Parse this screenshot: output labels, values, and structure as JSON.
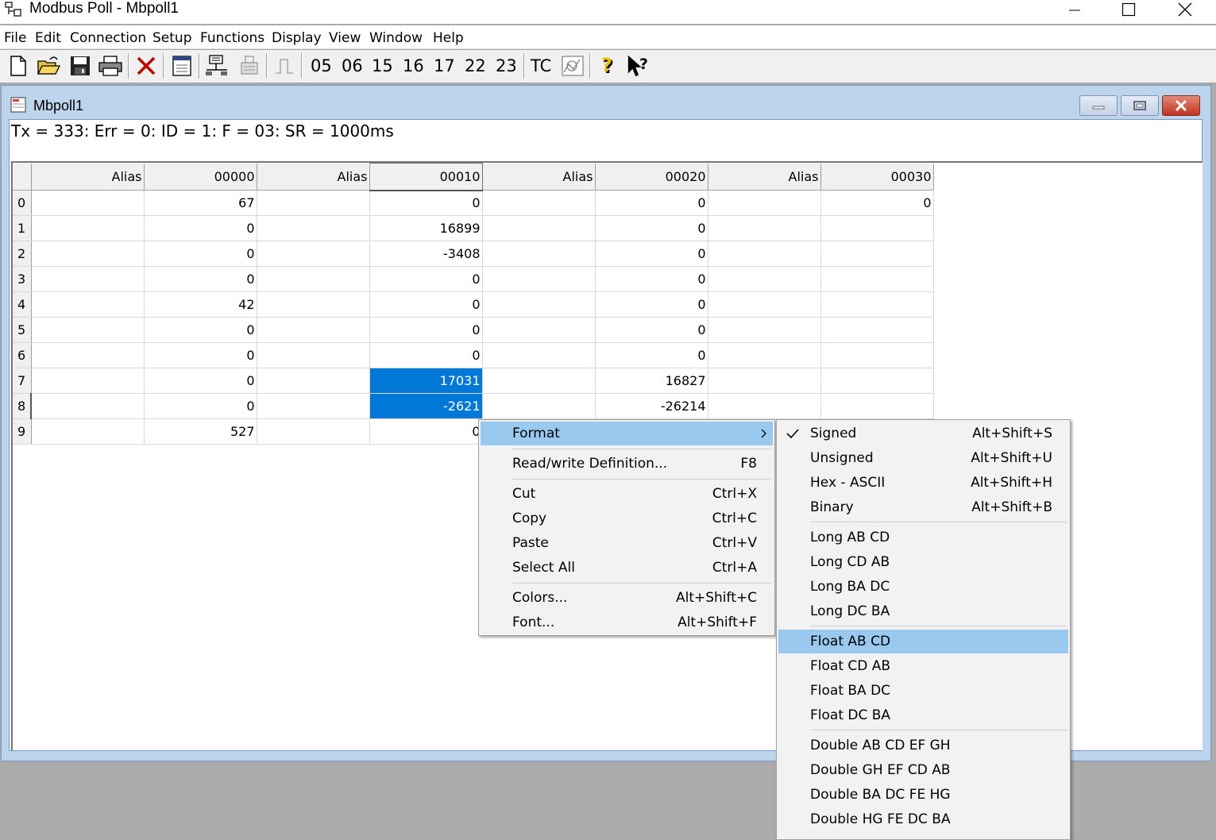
{
  "window": {
    "title": "Modbus Poll - Mbpoll1"
  },
  "menubar": [
    "File",
    "Edit",
    "Connection",
    "Setup",
    "Functions",
    "Display",
    "View",
    "Window",
    "Help"
  ],
  "toolbar": {
    "function_codes": [
      "05",
      "06",
      "15",
      "16",
      "17",
      "22",
      "23"
    ],
    "tc_label": "TC"
  },
  "child": {
    "title": "Mbpoll1",
    "status": "Tx = 333: Err = 0: ID = 1: F = 03: SR = 1000ms"
  },
  "grid": {
    "columns": [
      "Alias",
      "00000",
      "Alias",
      "00010",
      "Alias",
      "00020",
      "Alias",
      "00030"
    ],
    "rows": [
      {
        "index": "0",
        "v00000": "67",
        "v00010": "0",
        "v00020": "0",
        "v00030": "0"
      },
      {
        "index": "1",
        "v00000": "0",
        "v00010": "16899",
        "v00020": "0",
        "v00030": ""
      },
      {
        "index": "2",
        "v00000": "0",
        "v00010": "-3408",
        "v00020": "0",
        "v00030": ""
      },
      {
        "index": "3",
        "v00000": "0",
        "v00010": "0",
        "v00020": "0",
        "v00030": ""
      },
      {
        "index": "4",
        "v00000": "42",
        "v00010": "0",
        "v00020": "0",
        "v00030": ""
      },
      {
        "index": "5",
        "v00000": "0",
        "v00010": "0",
        "v00020": "0",
        "v00030": ""
      },
      {
        "index": "6",
        "v00000": "0",
        "v00010": "0",
        "v00020": "0",
        "v00030": ""
      },
      {
        "index": "7",
        "v00000": "0",
        "v00010": "17031",
        "v00020": "16827",
        "v00030": ""
      },
      {
        "index": "8",
        "v00000": "0",
        "v00010": "-2621",
        "v00020": "-26214",
        "v00030": ""
      },
      {
        "index": "9",
        "v00000": "527",
        "v00010": "0",
        "v00020": "",
        "v00030": ""
      }
    ]
  },
  "context_menu": {
    "format": "Format",
    "rw_definition": {
      "label": "Read/write Definition...",
      "shortcut": "F8"
    },
    "cut": {
      "label": "Cut",
      "shortcut": "Ctrl+X"
    },
    "copy": {
      "label": "Copy",
      "shortcut": "Ctrl+C"
    },
    "paste": {
      "label": "Paste",
      "shortcut": "Ctrl+V"
    },
    "select_all": {
      "label": "Select All",
      "shortcut": "Ctrl+A"
    },
    "colors": {
      "label": "Colors...",
      "shortcut": "Alt+Shift+C"
    },
    "font": {
      "label": "Font...",
      "shortcut": "Alt+Shift+F"
    }
  },
  "format_submenu": {
    "signed": {
      "label": "Signed",
      "shortcut": "Alt+Shift+S",
      "checked": true
    },
    "unsigned": {
      "label": "Unsigned",
      "shortcut": "Alt+Shift+U"
    },
    "hex_ascii": {
      "label": "Hex - ASCII",
      "shortcut": "Alt+Shift+H"
    },
    "binary": {
      "label": "Binary",
      "shortcut": "Alt+Shift+B"
    },
    "long_abcd": "Long AB CD",
    "long_cdab": "Long CD AB",
    "long_badc": "Long BA DC",
    "long_dcba": "Long DC BA",
    "float_abcd": "Float AB CD",
    "float_cdab": "Float CD AB",
    "float_badc": "Float BA DC",
    "float_dcba": "Float DC BA",
    "double_1": "Double AB CD EF GH",
    "double_2": "Double GH EF CD AB",
    "double_3": "Double BA DC FE HG",
    "double_4": "Double HG FE DC BA"
  },
  "colors": {
    "selection": "#0078d7",
    "menu_highlight": "#99c9ef",
    "mdi_frame": "#bcd4ec",
    "workspace": "#ababab"
  }
}
